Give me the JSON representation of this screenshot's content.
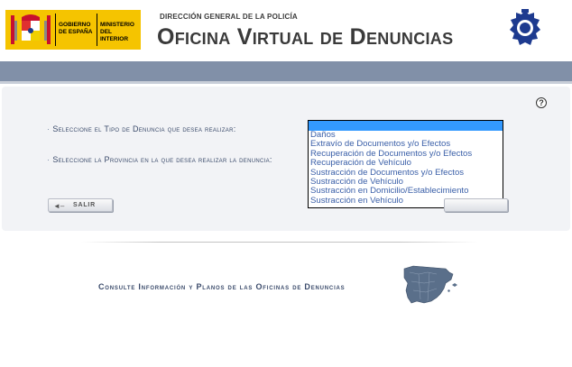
{
  "header": {
    "gobierno_text": "GOBIERNO DE ESPAÑA",
    "ministerio_text": "MINISTERIO DEL INTERIOR",
    "directorate": "DIRECCIÓN GENERAL DE LA POLICÍA",
    "title": "Oficina Virtual de Denuncias",
    "brand_yellow": "#f5c400",
    "crest_icon": "spain-coat-of-arms-icon",
    "badge_icon": "policia-badge-icon"
  },
  "band": {
    "color": "#8190a8"
  },
  "form": {
    "help_icon": "?",
    "tipo_label": "Seleccione el Tipo de Denuncia que desea realizar:",
    "provincia_label": "Seleccione la Provincia en la que desea realizar la denuncia:",
    "bullet": "·",
    "tipo_options": [
      "",
      "Daños",
      "Extravío de Documentos y/o Efectos",
      "Recuperación de Documentos y/o Efectos",
      "Recuperación de Vehículo",
      "Sustracción de Documentos y/o Efectos",
      "Sustracción de Vehículo",
      "Sustracción en Domicilio/Establecimiento",
      "Sustracción en Vehículo"
    ],
    "selected_index": 0,
    "salir_label": "SALIR",
    "salir_icon": "back-arrow-icon"
  },
  "footer": {
    "consult_link": "Consulte Información y Planos de las Oficinas de Denuncias",
    "map_icon": "spain-map-icon"
  }
}
